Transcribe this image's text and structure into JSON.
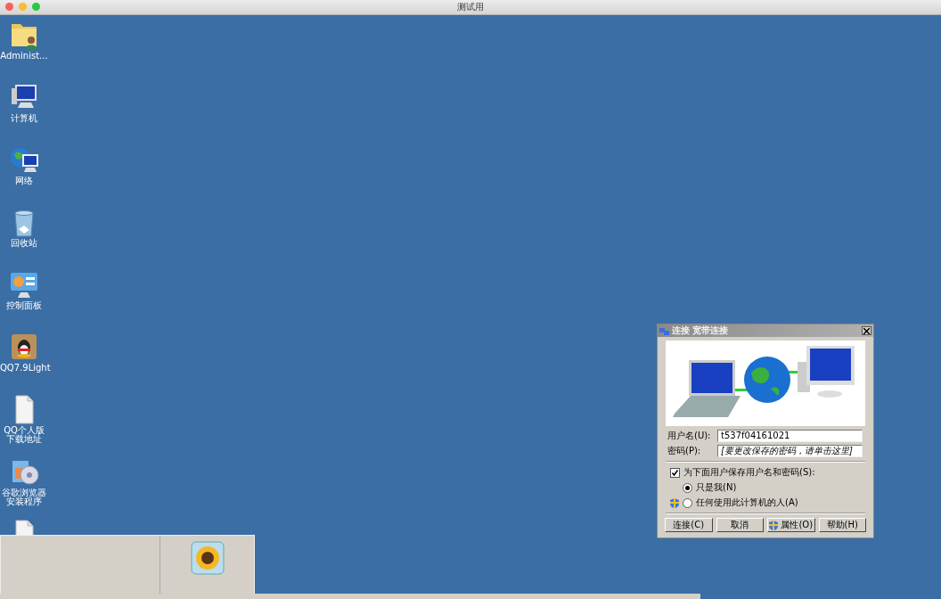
{
  "window": {
    "title": "测试用"
  },
  "desktop_icons": [
    {
      "kind": "user-folder",
      "label": "Administ..."
    },
    {
      "kind": "computer",
      "label": "计算机"
    },
    {
      "kind": "network",
      "label": "网络"
    },
    {
      "kind": "recycle-bin",
      "label": "回收站"
    },
    {
      "kind": "control-panel",
      "label": "控制面板"
    },
    {
      "kind": "qq",
      "label": "QQ7.9Light"
    },
    {
      "kind": "document",
      "label": "QQ个人版下载地址"
    },
    {
      "kind": "installer",
      "label": "谷歌浏览器安装程序"
    },
    {
      "kind": "document"
    }
  ],
  "dialog": {
    "title": "连接 宽带连接",
    "username": {
      "label": "用户名(U):",
      "value": "t537f04161021"
    },
    "password": {
      "label": "密码(P):",
      "value": "[要更改保存的密码，请单击这里]"
    },
    "save_credentials": {
      "label": "为下面用户保存用户名和密码(S):",
      "checked": true
    },
    "radios": [
      {
        "label": "只是我(N)",
        "selected": true,
        "shield": false
      },
      {
        "label": "任何使用此计算机的人(A)",
        "selected": false,
        "shield": true
      }
    ],
    "buttons": [
      {
        "label": "连接(C)",
        "shield": false
      },
      {
        "label": "取消",
        "shield": false
      },
      {
        "label": "属性(O)",
        "shield": true
      },
      {
        "label": "帮助(H)",
        "shield": false
      }
    ]
  }
}
